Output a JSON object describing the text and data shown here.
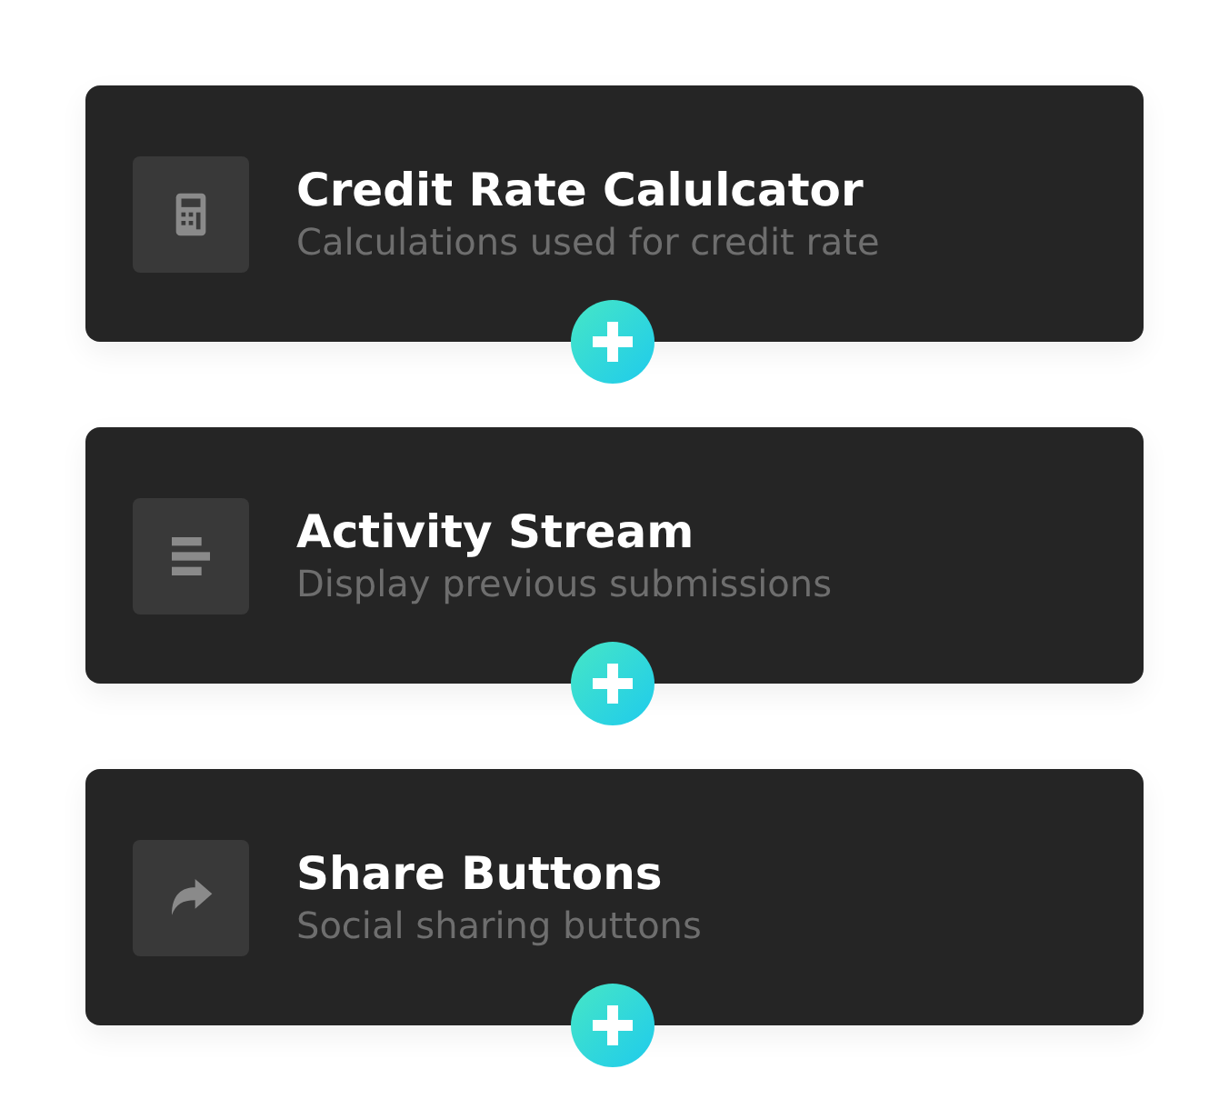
{
  "cards": [
    {
      "title": "Credit Rate Calulcator",
      "subtitle": "Calculations used for credit rate"
    },
    {
      "title": "Activity Stream",
      "subtitle": "Display previous submissions"
    },
    {
      "title": "Share Buttons",
      "subtitle": "Social sharing buttons"
    }
  ]
}
